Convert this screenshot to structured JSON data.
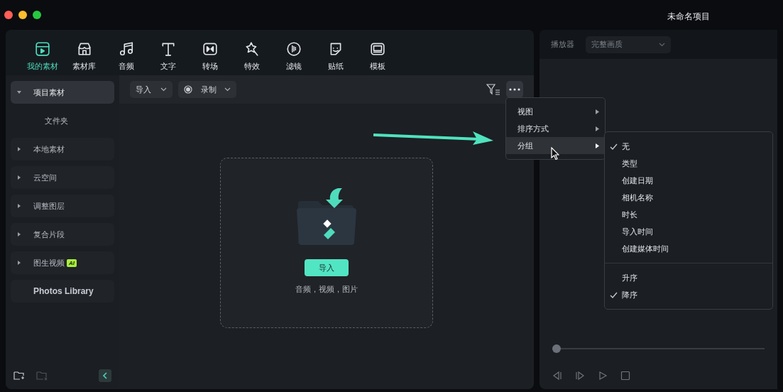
{
  "window": {
    "title": "未命名项目"
  },
  "tabs": [
    {
      "label": "我的素材",
      "selected": true
    },
    {
      "label": "素材库",
      "selected": false
    },
    {
      "label": "音频",
      "selected": false
    },
    {
      "label": "文字",
      "selected": false
    },
    {
      "label": "转场",
      "selected": false
    },
    {
      "label": "特效",
      "selected": false
    },
    {
      "label": "滤镜",
      "selected": false
    },
    {
      "label": "贴纸",
      "selected": false
    },
    {
      "label": "模板",
      "selected": false
    }
  ],
  "sidebar": {
    "items": [
      {
        "kind": "group",
        "label": "项目素材",
        "expanded": true,
        "selected": true,
        "children": [
          {
            "label": "文件夹"
          }
        ]
      },
      {
        "kind": "group",
        "label": "本地素材",
        "expanded": false,
        "selected": false
      },
      {
        "kind": "group",
        "label": "云空间",
        "expanded": false,
        "selected": false
      },
      {
        "kind": "group",
        "label": "调整图层",
        "expanded": false,
        "selected": false
      },
      {
        "kind": "group",
        "label": "复合片段",
        "expanded": false,
        "selected": false
      },
      {
        "kind": "group",
        "label": "图生视频",
        "badge": "AI",
        "expanded": false,
        "selected": false
      },
      {
        "kind": "link",
        "label": "Photos Library",
        "selected": false
      }
    ]
  },
  "toolbar": {
    "import_button": "导入",
    "record_button": "录制"
  },
  "drop_zone": {
    "button": "导入",
    "hint": "音频，视频，图片"
  },
  "menu": {
    "items": [
      {
        "label": "视图",
        "selected": false
      },
      {
        "label": "排序方式",
        "selected": false
      },
      {
        "label": "分组",
        "selected": true
      }
    ]
  },
  "submenu": {
    "sections": [
      [
        {
          "label": "无",
          "checked": true
        },
        {
          "label": "类型",
          "checked": false
        },
        {
          "label": "创建日期",
          "checked": false
        },
        {
          "label": "相机名称",
          "checked": false
        },
        {
          "label": "时长",
          "checked": false
        },
        {
          "label": "导入时间",
          "checked": false
        },
        {
          "label": "创建媒体时间",
          "checked": false
        }
      ],
      [
        {
          "label": "升序",
          "checked": false
        },
        {
          "label": "降序",
          "checked": true
        }
      ]
    ]
  },
  "player": {
    "label": "播放器",
    "quality": "完整画质",
    "progress": {
      "level": 0
    }
  }
}
